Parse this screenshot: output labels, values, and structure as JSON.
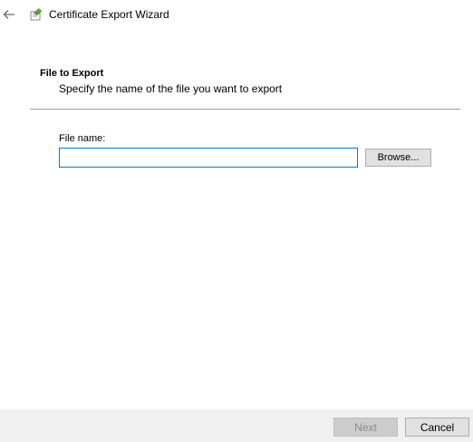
{
  "window": {
    "title": "Certificate Export Wizard",
    "back_icon": "back-arrow-icon",
    "app_icon": "certificate-wizard-icon"
  },
  "header": {
    "title": "File to Export",
    "description": "Specify the name of the file you want to export"
  },
  "form": {
    "file_name_label": "File name:",
    "file_name_value": "",
    "file_name_placeholder": "",
    "browse_label": "Browse..."
  },
  "footer": {
    "next_label": "Next",
    "next_enabled": false,
    "cancel_label": "Cancel"
  },
  "colors": {
    "accent": "#0078d7",
    "footer_bg": "#f0f0f0",
    "disabled_button_bg": "#cccccc"
  }
}
